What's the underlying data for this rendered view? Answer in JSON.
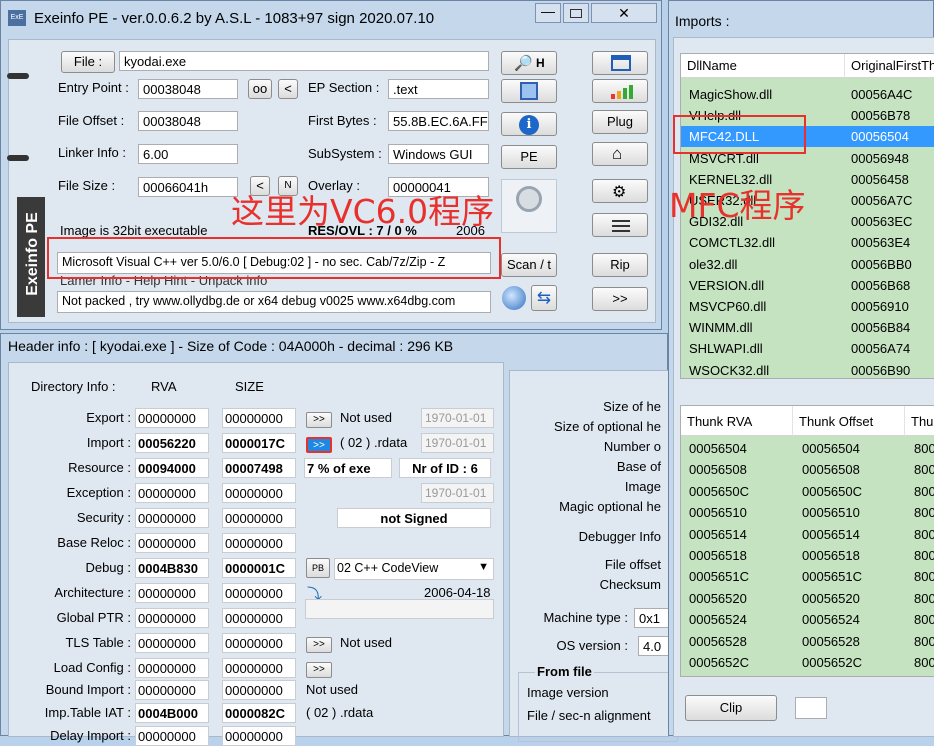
{
  "main": {
    "title": "Exeinfo PE - ver.0.0.6.2  by A.S.L -  1083+97 sign  2020.07.10",
    "file_btn": "File :",
    "file_value": "kyodai.exe",
    "entry_point_label": "Entry Point :",
    "entry_point": "00038048",
    "oo": "oo",
    "lt": "<",
    "ep_section_label": "EP Section :",
    "ep_section": ".text",
    "file_offset_label": "File Offset :",
    "file_offset": "00038048",
    "first_bytes_label": "First Bytes :",
    "first_bytes": "55.8B.EC.6A.FF",
    "linker_label": "Linker Info :",
    "linker": "6.00",
    "subsystem_label": "SubSystem :",
    "subsystem": "Windows GUI",
    "file_size_label": "File Size :",
    "file_size": "00066041h",
    "n": "N",
    "overlay_label": "Overlay :",
    "overlay": "00000041",
    "image_bits": "Image is 32bit executable",
    "res_ovl": "RES/OVL : 7 / 0 %",
    "year": "2006",
    "detect": "Microsoft Visual C++ ver 5.0/6.0 [ Debug:02 ]  - no sec. Cab/7z/Zip - Z",
    "lamer": "Lamer Info - Help Hint - Unpack info",
    "hint": "Not packed , try  www.ollydbg.de or x64 debug v0025 www.x64dbg.com",
    "scan_btn": "Scan / t",
    "rip_btn": "Rip",
    "plug_btn": "Plug",
    "pe_btn": "PE",
    "next_btn": ">>",
    "h_btn": "H",
    "logo": "Exeinfo PE",
    "annotation": "这里为VC6.0程序"
  },
  "header": {
    "title": "Header info  : [ kyodai.exe ] - Size of Code : 04A000h - decimal : 296 KB",
    "dir_label": "Directory Info :",
    "rva_col": "RVA",
    "size_col": "SIZE",
    "rows": [
      {
        "name": "Export :",
        "rva": "00000000",
        "size": "00000000",
        "extra": "Not used",
        "date": "1970-01-01"
      },
      {
        "name": "Import :",
        "rva": "00056220",
        "size": "0000017C",
        "extra": "( 02 ) .rdata",
        "date": "1970-01-01"
      },
      {
        "name": "Resource :",
        "rva": "00094000",
        "size": "00007498",
        "extra": "7  % of exe",
        "date": "Nr of ID : 6"
      },
      {
        "name": "Exception :",
        "rva": "00000000",
        "size": "00000000",
        "extra": "",
        "date": "1970-01-01"
      },
      {
        "name": "Security :",
        "rva": "00000000",
        "size": "00000000",
        "extra": "not Signed",
        "date": ""
      },
      {
        "name": "Base Reloc :",
        "rva": "00000000",
        "size": "00000000",
        "extra": "",
        "date": ""
      },
      {
        "name": "Debug :",
        "rva": "0004B830",
        "size": "0000001C",
        "extra": "02  C++ CodeView",
        "date": ""
      },
      {
        "name": "Architecture :",
        "rva": "00000000",
        "size": "00000000",
        "extra": "",
        "date": "2006-04-18"
      },
      {
        "name": "Global PTR :",
        "rva": "00000000",
        "size": "00000000",
        "extra": "",
        "date": ""
      },
      {
        "name": "TLS Table :",
        "rva": "00000000",
        "size": "00000000",
        "extra": "Not used",
        "date": ""
      },
      {
        "name": "Load Config :",
        "rva": "00000000",
        "size": "00000000",
        "extra": "",
        "date": ""
      },
      {
        "name": "Bound Import :",
        "rva": "00000000",
        "size": "00000000",
        "extra": "Not used",
        "date": ""
      },
      {
        "name": "Imp.Table IAT :",
        "rva": "0004B000",
        "size": "0000082C",
        "extra": "( 02 ) .rdata",
        "date": ""
      },
      {
        "name": "Delay Import :",
        "rva": "00000000",
        "size": "00000000",
        "extra": "",
        "date": ""
      }
    ],
    "pb": "PB",
    "right_labels": [
      "Size of he",
      "Size of optional he",
      "Number o",
      "Base of",
      "Image",
      "Magic optional he",
      "Debugger Info",
      "File offset",
      "Checksum",
      "Machine type :",
      "OS version :"
    ],
    "machine": "0x1",
    "os": "4.0",
    "from_file": "From file",
    "image_version": "Image version",
    "file_align": "File / sec-n alignment"
  },
  "imports": {
    "title": "Imports :",
    "col1": "DllName",
    "col2": "OriginalFirstTh",
    "dlls": [
      {
        "name": "MagicShow.dll",
        "oft": "00056A4C"
      },
      {
        "name": "VHelp.dll",
        "oft": "00056B78"
      },
      {
        "name": "MFC42.DLL",
        "oft": "00056504"
      },
      {
        "name": "MSVCRT.dll",
        "oft": "00056948"
      },
      {
        "name": "KERNEL32.dll",
        "oft": "00056458"
      },
      {
        "name": "USER32.dll",
        "oft": "00056A7C"
      },
      {
        "name": "GDI32.dll",
        "oft": "000563EC"
      },
      {
        "name": "COMCTL32.dll",
        "oft": "000563E4"
      },
      {
        "name": "ole32.dll",
        "oft": "00056BB0"
      },
      {
        "name": "VERSION.dll",
        "oft": "00056B68"
      },
      {
        "name": "MSVCP60.dll",
        "oft": "00056910"
      },
      {
        "name": "WINMM.dll",
        "oft": "00056B84"
      },
      {
        "name": "SHLWAPI.dll",
        "oft": "00056A74"
      },
      {
        "name": "WSOCK32.dll",
        "oft": "00056B90"
      }
    ],
    "thunk_cols": [
      "Thunk RVA",
      "Thunk Offset",
      "Thu"
    ],
    "thunks": [
      {
        "rva": "00056504",
        "off": "00056504",
        "t": "800"
      },
      {
        "rva": "00056508",
        "off": "00056508",
        "t": "800"
      },
      {
        "rva": "0005650C",
        "off": "0005650C",
        "t": "800"
      },
      {
        "rva": "00056510",
        "off": "00056510",
        "t": "800"
      },
      {
        "rva": "00056514",
        "off": "00056514",
        "t": "800"
      },
      {
        "rva": "00056518",
        "off": "00056518",
        "t": "800"
      },
      {
        "rva": "0005651C",
        "off": "0005651C",
        "t": "800"
      },
      {
        "rva": "00056520",
        "off": "00056520",
        "t": "800"
      },
      {
        "rva": "00056524",
        "off": "00056524",
        "t": "800"
      },
      {
        "rva": "00056528",
        "off": "00056528",
        "t": "800"
      },
      {
        "rva": "0005652C",
        "off": "0005652C",
        "t": "800"
      }
    ],
    "clip": "Clip",
    "annotation": "MFC程序"
  },
  "colors": {
    "green": "#c5e3c0",
    "selected": "#3399ff",
    "accent_red": "#e8302c"
  }
}
